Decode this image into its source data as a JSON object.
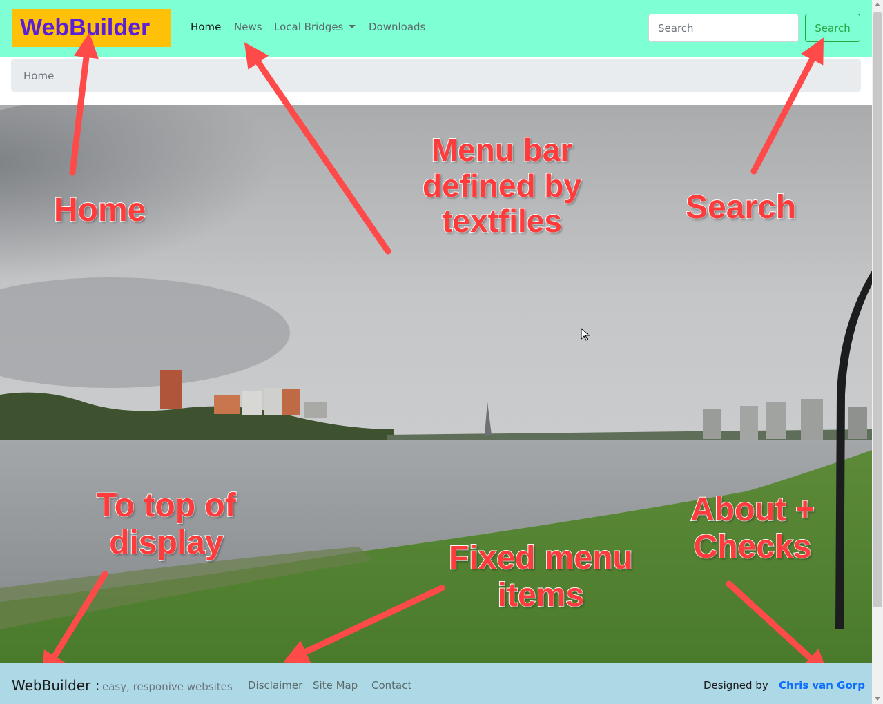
{
  "navbar": {
    "brand": "WebBuilder",
    "links": [
      {
        "label": "Home"
      },
      {
        "label": "News"
      },
      {
        "label": "Local Bridges"
      },
      {
        "label": "Downloads"
      }
    ],
    "search_placeholder": "Search",
    "search_button": "Search",
    "bg_color": "#7fffd4",
    "brand_bg": "#ffc107",
    "brand_color": "#5a1fd6"
  },
  "breadcrumb": {
    "items": [
      "Home"
    ]
  },
  "annotations": {
    "home": "Home",
    "menu_bar": [
      "Menu bar",
      "defined by",
      "textfiles"
    ],
    "search": "Search",
    "to_top": [
      "To top of",
      "display"
    ],
    "fixed_menu": [
      "Fixed menu",
      "items"
    ],
    "about": [
      "About +",
      "Checks"
    ],
    "color": "#ff3b3b"
  },
  "footer": {
    "brand": "WebBuilder",
    "separator": ":",
    "tagline": "easy, responive websites",
    "links": [
      {
        "label": "Disclaimer"
      },
      {
        "label": "Site Map"
      },
      {
        "label": "Contact"
      }
    ],
    "designed_by": "Designed by",
    "author": "Chris van Gorp",
    "bg_color": "#add8e6"
  }
}
